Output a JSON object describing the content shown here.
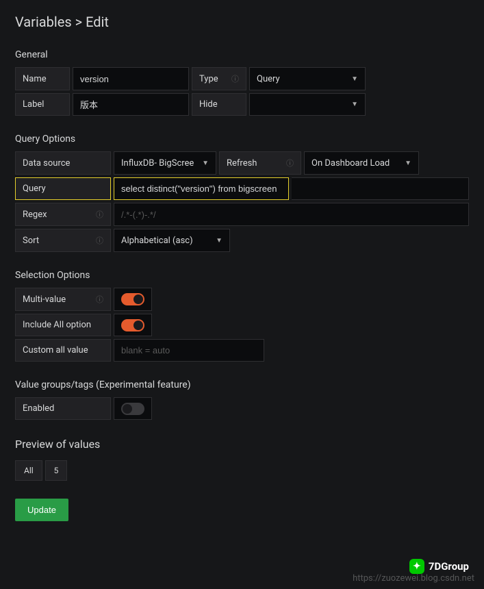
{
  "page": {
    "title": "Variables > Edit"
  },
  "general": {
    "heading": "General",
    "name_label": "Name",
    "name_value": "version",
    "type_label": "Type",
    "type_value": "Query",
    "label_label": "Label",
    "label_value": "版本",
    "hide_label": "Hide",
    "hide_value": ""
  },
  "query_options": {
    "heading": "Query Options",
    "datasource_label": "Data source",
    "datasource_value": "InfluxDB- BigScree",
    "refresh_label": "Refresh",
    "refresh_value": "On Dashboard Load",
    "query_label": "Query",
    "query_value": "select distinct(\"version\") from bigscreen",
    "regex_label": "Regex",
    "regex_placeholder": "/.*-(.*)-.*/",
    "sort_label": "Sort",
    "sort_value": "Alphabetical (asc)"
  },
  "selection_options": {
    "heading": "Selection Options",
    "multi_label": "Multi-value",
    "include_all_label": "Include All option",
    "custom_all_label": "Custom all value",
    "custom_all_placeholder": "blank = auto"
  },
  "value_groups": {
    "heading": "Value groups/tags (Experimental feature)",
    "enabled_label": "Enabled"
  },
  "preview": {
    "heading": "Preview of values",
    "values": [
      "All",
      "5"
    ]
  },
  "actions": {
    "update_label": "Update"
  },
  "watermark": {
    "logo": "7DGroup",
    "url": "https://zuozewei.blog.csdn.net"
  },
  "info_icon": "ⓘ",
  "caret": "▼"
}
